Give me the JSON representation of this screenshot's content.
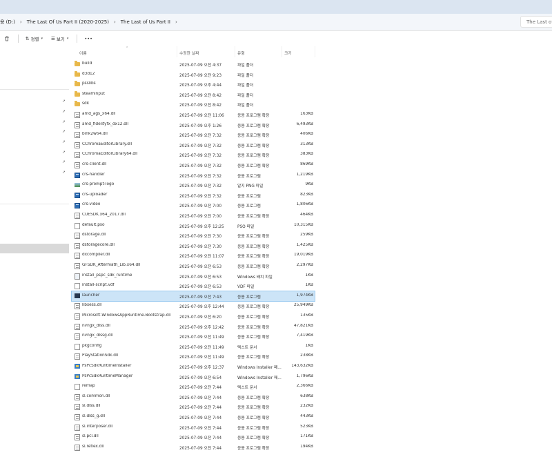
{
  "address": {
    "crumbs": [
      "용 (D:)",
      "The Last Of Us Part II (2020-2025)",
      "The Last of Us Part II"
    ],
    "search_text": "The Last of"
  },
  "toolbar": {
    "sort_label": "정렬",
    "view_label": "보기",
    "more_label": "•••"
  },
  "columns": {
    "name": "이름",
    "date": "수정한 날짜",
    "type": "유형",
    "size": "크기"
  },
  "files": [
    {
      "icon": "folder",
      "name": "build",
      "date": "2025-07-09 오전 4:37",
      "type": "파일 폴더",
      "size": ""
    },
    {
      "icon": "folder",
      "name": "d3d12",
      "date": "2025-07-09 오전 9:23",
      "type": "파일 폴더",
      "size": ""
    },
    {
      "icon": "folder",
      "name": "psslibs",
      "date": "2025-07-09 오후 4:44",
      "type": "파일 폴더",
      "size": ""
    },
    {
      "icon": "folder",
      "name": "steaminput",
      "date": "2025-07-09 오전 8:42",
      "type": "파일 폴더",
      "size": ""
    },
    {
      "icon": "folder",
      "name": "sdk",
      "date": "2025-07-09 오전 8:42",
      "type": "파일 폴더",
      "size": ""
    },
    {
      "icon": "dll",
      "name": "amd_ags_x64.dll",
      "date": "2025-07-09 오전 11:06",
      "type": "응용 프로그램 확장",
      "size": "163KB"
    },
    {
      "icon": "dll",
      "name": "amd_fidelityfx_dx12.dll",
      "date": "2025-07-09 오후 1:26",
      "type": "응용 프로그램 확장",
      "size": "6,493KB"
    },
    {
      "icon": "dll",
      "name": "bink2w64.dll",
      "date": "2025-07-09 오전 7:32",
      "type": "응용 프로그램 확장",
      "size": "406KB"
    },
    {
      "icon": "dll",
      "name": "CChromaEditorLibrary.dll",
      "date": "2025-07-09 오전 7:32",
      "type": "응용 프로그램 확장",
      "size": "313KB"
    },
    {
      "icon": "dll",
      "name": "CChromaEditorLibrary64.dll",
      "date": "2025-07-09 오전 7:32",
      "type": "응용 프로그램 확장",
      "size": "383KB"
    },
    {
      "icon": "dll",
      "name": "crs-client.dll",
      "date": "2025-07-09 오전 7:32",
      "type": "응용 프로그램 확장",
      "size": "869KB"
    },
    {
      "icon": "exe",
      "name": "crs-handler",
      "date": "2025-07-09 오전 7:32",
      "type": "응용 프로그램",
      "size": "1,219KB"
    },
    {
      "icon": "png",
      "name": "crs-prompt-logo",
      "date": "2025-07-09 오전 7:32",
      "type": "알지 PNG 파일",
      "size": "9KB"
    },
    {
      "icon": "exe",
      "name": "crs-uploader",
      "date": "2025-07-09 오전 7:32",
      "type": "응용 프로그램",
      "size": "823KB"
    },
    {
      "icon": "exe",
      "name": "crs-video",
      "date": "2025-07-09 오전 7:00",
      "type": "응용 프로그램",
      "size": "1,806KB"
    },
    {
      "icon": "dll",
      "name": "CUESDK.x64_2017.dll",
      "date": "2025-07-09 오전 7:00",
      "type": "응용 프로그램 확장",
      "size": "464KB"
    },
    {
      "icon": "file",
      "name": "default.pso",
      "date": "2025-07-09 오후 12:25",
      "type": "PSO 파일",
      "size": "10,315KB"
    },
    {
      "icon": "dll",
      "name": "dstorage.dll",
      "date": "2025-07-09 오전 7:30",
      "type": "응용 프로그램 확장",
      "size": "259KB"
    },
    {
      "icon": "dll",
      "name": "dstoragecore.dll",
      "date": "2025-07-09 오전 7:30",
      "type": "응용 프로그램 확장",
      "size": "1,425KB"
    },
    {
      "icon": "dll",
      "name": "dxcompiler.dll",
      "date": "2025-07-09 오전 11:07",
      "type": "응용 프로그램 확장",
      "size": "19,019KB"
    },
    {
      "icon": "dll",
      "name": "GFSDK_Aftermath_Lib.x64.dll",
      "date": "2025-07-09 오전 6:53",
      "type": "응용 프로그램 확장",
      "size": "2,297KB"
    },
    {
      "icon": "sx",
      "name": "install_pspc_sdk_runtime",
      "date": "2025-07-09 오전 6:53",
      "type": "Windows 배치 파일",
      "size": "1KB"
    },
    {
      "icon": "file",
      "name": "install-script.vdf",
      "date": "2025-07-09 오전 6:53",
      "type": "VDF 파일",
      "size": "1KB"
    },
    {
      "icon": "app",
      "name": "launcher",
      "date": "2025-07-09 오전 7:43",
      "type": "응용 프로그램",
      "size": "1,974KB",
      "selected": true
    },
    {
      "icon": "dll",
      "name": "libxess.dll",
      "date": "2025-07-09 오후 12:44",
      "type": "응용 프로그램 확장",
      "size": "25,949KB"
    },
    {
      "icon": "dll",
      "name": "Microsoft.WindowsAppRuntime.Bootstrap.dll",
      "date": "2025-07-09 오전 6:20",
      "type": "응용 프로그램 확장",
      "size": "135KB"
    },
    {
      "icon": "dll",
      "name": "nvngx_dlss.dll",
      "date": "2025-07-09 오후 12:42",
      "type": "응용 프로그램 확장",
      "size": "47,821KB"
    },
    {
      "icon": "dll",
      "name": "nvngx_dlssg.dll",
      "date": "2025-07-09 오전 11:49",
      "type": "응용 프로그램 확장",
      "size": "7,419KB"
    },
    {
      "icon": "file",
      "name": "pkgconfig",
      "date": "2025-07-09 오전 11:49",
      "type": "텍스트 문서",
      "size": "1KB"
    },
    {
      "icon": "dll",
      "name": "PlayStationSdk.dll",
      "date": "2025-07-09 오전 11:49",
      "type": "응용 프로그램 확장",
      "size": "238KB"
    },
    {
      "icon": "msi",
      "name": "PsPcSdkRuntimeInstaller",
      "date": "2025-07-09 오후 12:37",
      "type": "Windows Installer 패...",
      "size": "143,632KB"
    },
    {
      "icon": "msi",
      "name": "PsPcSdkRuntimeManager",
      "date": "2025-07-09 오전 6:54",
      "type": "Windows Installer 패...",
      "size": "1,796KB"
    },
    {
      "icon": "file",
      "name": "remap",
      "date": "2025-07-09 오전 7:44",
      "type": "텍스트 문서",
      "size": "2,366KB"
    },
    {
      "icon": "dll",
      "name": "sl.common.dll",
      "date": "2025-07-09 오전 7:44",
      "type": "응용 프로그램 확장",
      "size": "638KB"
    },
    {
      "icon": "dll",
      "name": "sl.dlss.dll",
      "date": "2025-07-09 오전 7:44",
      "type": "응용 프로그램 확장",
      "size": "232KB"
    },
    {
      "icon": "dll",
      "name": "sl.dlss_g.dll",
      "date": "2025-07-09 오전 7:44",
      "type": "응용 프로그램 확장",
      "size": "443KB"
    },
    {
      "icon": "dll",
      "name": "sl.interposer.dll",
      "date": "2025-07-09 오전 7:44",
      "type": "응용 프로그램 확장",
      "size": "523KB"
    },
    {
      "icon": "dll",
      "name": "sl.pcl.dll",
      "date": "2025-07-09 오전 7:44",
      "type": "응용 프로그램 확장",
      "size": "171KB"
    },
    {
      "icon": "dll",
      "name": "sl.reflex.dll",
      "date": "2025-07-09 오전 7:44",
      "type": "응용 프로그램 확장",
      "size": "194KB"
    }
  ]
}
